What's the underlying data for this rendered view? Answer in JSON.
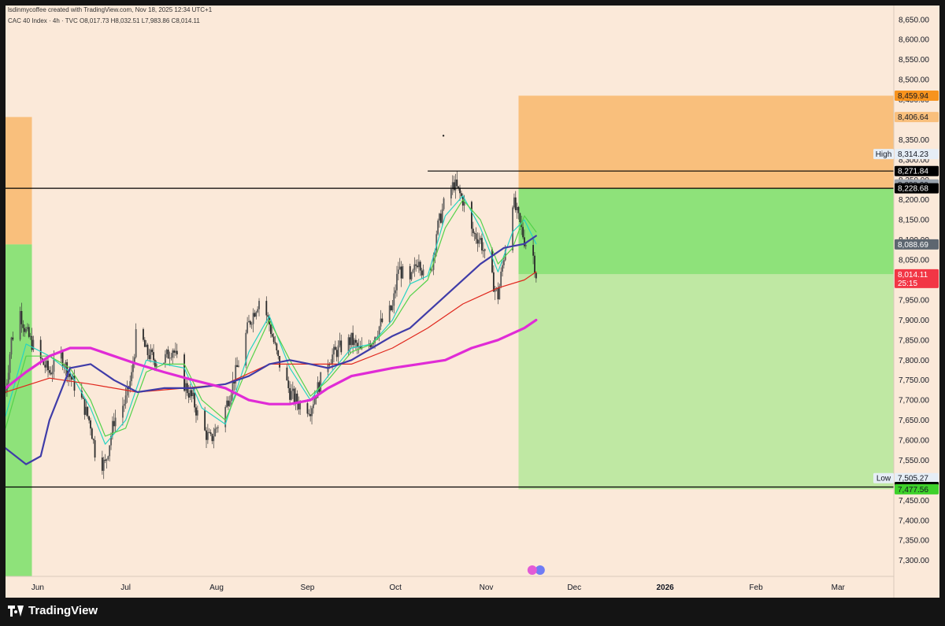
{
  "header": {
    "credit": "lsdinmycoffee created with TradingView.com, Nov 18, 2025 12:34 UTC+1",
    "ohlc": "CAC 40 Index · 4h · TVC  O8,017.73  H8,032.51  L7,983.86  C8,014.11"
  },
  "footer": {
    "brand": "TradingView"
  },
  "colors": {
    "background": "#fbe9d9",
    "zone_orange": "#f9bf7c",
    "zone_green": "#8ee27a",
    "zone_green_light": "#bfe8a3",
    "ma_fast": "#26d4c4",
    "ma_medium": "#54d24a",
    "ma_red": "#e0261c",
    "ma_blue": "#3f3ca8",
    "ma_magenta": "#e02bd6",
    "candles": "#3c3c3c"
  },
  "chart_data": {
    "type": "line",
    "symbol": "CAC 40 Index",
    "timeframe": "4h",
    "x_tick_labels": [
      "Jun",
      "Jul",
      "Aug",
      "Sep",
      "Oct",
      "Nov",
      "Dec",
      "2026",
      "Feb",
      "Mar"
    ],
    "y_tick_labels": [
      "8,650.00",
      "8,600.00",
      "8,550.00",
      "8,500.00",
      "8,450.00",
      "8,350.00",
      "8,300.00",
      "8,250.00",
      "8,200.00",
      "8,150.00",
      "8,100.00",
      "8,050.00",
      "7,950.00",
      "7,900.00",
      "7,850.00",
      "7,800.00",
      "7,750.00",
      "7,700.00",
      "7,650.00",
      "7,600.00",
      "7,550.00",
      "7,450.00",
      "7,400.00",
      "7,350.00",
      "7,300.00"
    ],
    "ylim": [
      7260,
      8680
    ],
    "price_path": [
      [
        "2025-05-21",
        7720
      ],
      [
        "2025-05-23",
        7850
      ],
      [
        "2025-05-26",
        7920
      ],
      [
        "2025-05-28",
        7870
      ],
      [
        "2025-06-02",
        7800
      ],
      [
        "2025-06-05",
        7770
      ],
      [
        "2025-06-09",
        7810
      ],
      [
        "2025-06-12",
        7760
      ],
      [
        "2025-06-16",
        7700
      ],
      [
        "2025-06-19",
        7640
      ],
      [
        "2025-06-21",
        7550
      ],
      [
        "2025-06-24",
        7540
      ],
      [
        "2025-06-27",
        7650
      ],
      [
        "2025-07-01",
        7700
      ],
      [
        "2025-07-03",
        7760
      ],
      [
        "2025-07-05",
        7890
      ],
      [
        "2025-07-08",
        7820
      ],
      [
        "2025-07-11",
        7800
      ],
      [
        "2025-07-14",
        7800
      ],
      [
        "2025-07-17",
        7830
      ],
      [
        "2025-07-21",
        7740
      ],
      [
        "2025-07-24",
        7700
      ],
      [
        "2025-07-27",
        7630
      ],
      [
        "2025-07-30",
        7600
      ],
      [
        "2025-08-04",
        7680
      ],
      [
        "2025-08-08",
        7780
      ],
      [
        "2025-08-12",
        7890
      ],
      [
        "2025-08-16",
        7960
      ],
      [
        "2025-08-19",
        7890
      ],
      [
        "2025-08-22",
        7800
      ],
      [
        "2025-08-26",
        7720
      ],
      [
        "2025-08-29",
        7690
      ],
      [
        "2025-09-02",
        7680
      ],
      [
        "2025-09-05",
        7740
      ],
      [
        "2025-09-08",
        7800
      ],
      [
        "2025-09-12",
        7830
      ],
      [
        "2025-09-16",
        7850
      ],
      [
        "2025-09-19",
        7820
      ],
      [
        "2025-09-23",
        7850
      ],
      [
        "2025-09-26",
        7890
      ],
      [
        "2025-09-30",
        7930
      ],
      [
        "2025-10-02",
        8030
      ],
      [
        "2025-10-06",
        7990
      ],
      [
        "2025-10-09",
        8060
      ],
      [
        "2025-10-12",
        7960
      ],
      [
        "2025-10-15",
        8120
      ],
      [
        "2025-10-18",
        8200
      ],
      [
        "2025-10-21",
        8240
      ],
      [
        "2025-10-24",
        8200
      ],
      [
        "2025-10-27",
        8120
      ],
      [
        "2025-10-30",
        8100
      ],
      [
        "2025-11-02",
        8020
      ],
      [
        "2025-11-05",
        7960
      ],
      [
        "2025-11-07",
        8060
      ],
      [
        "2025-11-10",
        8200
      ],
      [
        "2025-11-12",
        8150
      ],
      [
        "2025-11-14",
        8100
      ],
      [
        "2025-11-17",
        8060
      ],
      [
        "2025-11-18",
        8014
      ]
    ],
    "series": [
      {
        "name": "",
        "color": "#26d4c4",
        "values": [
          [
            "2025-05-21",
            7660
          ],
          [
            "2025-05-28",
            7840
          ],
          [
            "2025-06-05",
            7810
          ],
          [
            "2025-06-12",
            7770
          ],
          [
            "2025-06-19",
            7680
          ],
          [
            "2025-06-24",
            7590
          ],
          [
            "2025-07-01",
            7650
          ],
          [
            "2025-07-08",
            7800
          ],
          [
            "2025-07-14",
            7790
          ],
          [
            "2025-07-21",
            7780
          ],
          [
            "2025-07-27",
            7680
          ],
          [
            "2025-08-04",
            7640
          ],
          [
            "2025-08-12",
            7820
          ],
          [
            "2025-08-19",
            7910
          ],
          [
            "2025-08-26",
            7780
          ],
          [
            "2025-09-02",
            7700
          ],
          [
            "2025-09-08",
            7760
          ],
          [
            "2025-09-16",
            7830
          ],
          [
            "2025-09-23",
            7840
          ],
          [
            "2025-09-30",
            7900
          ],
          [
            "2025-10-06",
            7990
          ],
          [
            "2025-10-12",
            8010
          ],
          [
            "2025-10-18",
            8160
          ],
          [
            "2025-10-24",
            8210
          ],
          [
            "2025-10-30",
            8130
          ],
          [
            "2025-11-05",
            8020
          ],
          [
            "2025-11-10",
            8120
          ],
          [
            "2025-11-14",
            8150
          ],
          [
            "2025-11-18",
            8090
          ]
        ]
      },
      {
        "name": "",
        "color": "#54d24a",
        "values": [
          [
            "2025-05-21",
            7630
          ],
          [
            "2025-05-28",
            7810
          ],
          [
            "2025-06-05",
            7810
          ],
          [
            "2025-06-12",
            7780
          ],
          [
            "2025-06-19",
            7700
          ],
          [
            "2025-06-24",
            7610
          ],
          [
            "2025-07-01",
            7630
          ],
          [
            "2025-07-08",
            7770
          ],
          [
            "2025-07-14",
            7790
          ],
          [
            "2025-07-21",
            7790
          ],
          [
            "2025-07-27",
            7700
          ],
          [
            "2025-08-04",
            7650
          ],
          [
            "2025-08-12",
            7790
          ],
          [
            "2025-08-19",
            7900
          ],
          [
            "2025-08-26",
            7800
          ],
          [
            "2025-09-02",
            7710
          ],
          [
            "2025-09-08",
            7750
          ],
          [
            "2025-09-16",
            7820
          ],
          [
            "2025-09-23",
            7840
          ],
          [
            "2025-09-30",
            7890
          ],
          [
            "2025-10-06",
            7960
          ],
          [
            "2025-10-12",
            8000
          ],
          [
            "2025-10-18",
            8130
          ],
          [
            "2025-10-24",
            8200
          ],
          [
            "2025-10-30",
            8150
          ],
          [
            "2025-11-05",
            8040
          ],
          [
            "2025-11-10",
            8080
          ],
          [
            "2025-11-14",
            8160
          ],
          [
            "2025-11-18",
            8120
          ]
        ]
      },
      {
        "name": "",
        "color": "#e0261c",
        "values": [
          [
            "2025-05-21",
            7720
          ],
          [
            "2025-06-05",
            7755
          ],
          [
            "2025-06-19",
            7740
          ],
          [
            "2025-07-05",
            7720
          ],
          [
            "2025-07-21",
            7730
          ],
          [
            "2025-08-04",
            7740
          ],
          [
            "2025-08-19",
            7790
          ],
          [
            "2025-09-02",
            7790
          ],
          [
            "2025-09-16",
            7790
          ],
          [
            "2025-09-30",
            7830
          ],
          [
            "2025-10-12",
            7880
          ],
          [
            "2025-10-24",
            7940
          ],
          [
            "2025-11-05",
            7980
          ],
          [
            "2025-11-14",
            8000
          ],
          [
            "2025-11-18",
            8020
          ]
        ]
      },
      {
        "name": "",
        "color": "#3f3ca8",
        "values": [
          [
            "2025-05-21",
            7580
          ],
          [
            "2025-05-28",
            7540
          ],
          [
            "2025-06-02",
            7560
          ],
          [
            "2025-06-05",
            7650
          ],
          [
            "2025-06-12",
            7780
          ],
          [
            "2025-06-19",
            7790
          ],
          [
            "2025-06-27",
            7750
          ],
          [
            "2025-07-05",
            7720
          ],
          [
            "2025-07-14",
            7730
          ],
          [
            "2025-07-24",
            7730
          ],
          [
            "2025-08-04",
            7740
          ],
          [
            "2025-08-12",
            7760
          ],
          [
            "2025-08-19",
            7790
          ],
          [
            "2025-08-26",
            7800
          ],
          [
            "2025-09-02",
            7790
          ],
          [
            "2025-09-08",
            7780
          ],
          [
            "2025-09-16",
            7800
          ],
          [
            "2025-09-23",
            7830
          ],
          [
            "2025-09-30",
            7860
          ],
          [
            "2025-10-06",
            7880
          ],
          [
            "2025-10-12",
            7920
          ],
          [
            "2025-10-21",
            7980
          ],
          [
            "2025-10-30",
            8040
          ],
          [
            "2025-11-07",
            8080
          ],
          [
            "2025-11-14",
            8090
          ],
          [
            "2025-11-18",
            8110
          ]
        ]
      },
      {
        "name": "",
        "color": "#e02bd6",
        "values": [
          [
            "2025-05-21",
            7730
          ],
          [
            "2025-05-28",
            7770
          ],
          [
            "2025-06-05",
            7810
          ],
          [
            "2025-06-12",
            7830
          ],
          [
            "2025-06-19",
            7830
          ],
          [
            "2025-06-27",
            7810
          ],
          [
            "2025-07-05",
            7790
          ],
          [
            "2025-07-14",
            7770
          ],
          [
            "2025-07-24",
            7750
          ],
          [
            "2025-08-04",
            7730
          ],
          [
            "2025-08-12",
            7700
          ],
          [
            "2025-08-19",
            7690
          ],
          [
            "2025-08-26",
            7690
          ],
          [
            "2025-09-02",
            7700
          ],
          [
            "2025-09-08",
            7730
          ],
          [
            "2025-09-16",
            7760
          ],
          [
            "2025-09-23",
            7770
          ],
          [
            "2025-09-30",
            7780
          ],
          [
            "2025-10-09",
            7790
          ],
          [
            "2025-10-18",
            7800
          ],
          [
            "2025-10-27",
            7830
          ],
          [
            "2025-11-05",
            7850
          ],
          [
            "2025-11-14",
            7880
          ],
          [
            "2025-11-18",
            7900
          ]
        ]
      }
    ],
    "zones": [
      {
        "name": "",
        "color": "#f9bf7c",
        "x_start": "2025-05-21",
        "x_end": "2025-05-30",
        "y_low": 8088.69,
        "y_high": 8406.64
      },
      {
        "name": "",
        "color": "#8ee27a",
        "x_start": "2025-05-21",
        "x_end": "2025-05-30",
        "y_low": 7260,
        "y_high": 8088.69
      },
      {
        "name": "",
        "color": "#f9bf7c",
        "x_start": "2025-11-12",
        "x_end": "2026-03-20",
        "y_low": 8228.68,
        "y_high": 8459.94
      },
      {
        "name": "",
        "color": "#8ee27a",
        "x_start": "2025-11-12",
        "x_end": "2026-03-20",
        "y_low": 8014.11,
        "y_high": 8228.68
      },
      {
        "name": "",
        "color": "#bfe8a3",
        "x_start": "2025-11-12",
        "x_end": "2026-03-20",
        "y_low": 7477.56,
        "y_high": 8014.11
      }
    ],
    "horizontal_lines": [
      {
        "y": 8228.68,
        "x_start": "2025-05-21",
        "x_end": "2026-03-20"
      },
      {
        "y": 8271.84,
        "x_start": "2025-10-12",
        "x_end": "2026-03-20"
      },
      {
        "y": 7483.04,
        "x_start": "2025-05-21",
        "x_end": "2026-03-20"
      }
    ],
    "price_badges": [
      {
        "label": "",
        "value": "8,459.94",
        "bg": "#f7931e",
        "fg": "#131722"
      },
      {
        "label": "",
        "value": "8,406.64",
        "bg": "#f9bf7c",
        "fg": "#131722"
      },
      {
        "label": "High",
        "value": "8,314.23",
        "bg": "#e6eef6",
        "fg": "#131722"
      },
      {
        "label": "",
        "value": "8,271.84",
        "bg": "#000000",
        "fg": "#ffffff"
      },
      {
        "label": "",
        "value": "8,238.29",
        "bg": "#9aa3ad",
        "fg": "#131722"
      },
      {
        "label": "",
        "value": "8,228.68",
        "bg": "#000000",
        "fg": "#ffffff"
      },
      {
        "label": "",
        "value": "8,088.69",
        "bg": "#5d6670",
        "fg": "#ffffff"
      },
      {
        "label": "",
        "value": "8,014.11",
        "bg": "#f23645",
        "fg": "#ffffff",
        "sub": "25:15"
      },
      {
        "label": "Low",
        "value": "7,505.27",
        "bg": "#e6eef6",
        "fg": "#131722"
      },
      {
        "label": "",
        "value": "7,483.04",
        "bg": "#000000",
        "fg": "#ffffff"
      },
      {
        "label": "",
        "value": "7,477.56",
        "bg": "#3ed12b",
        "fg": "#131722"
      }
    ]
  }
}
